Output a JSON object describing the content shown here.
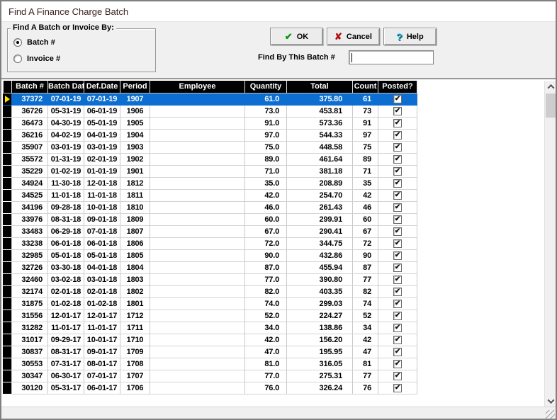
{
  "window": {
    "title": "Find A Finance Charge Batch"
  },
  "icons": {
    "check": "✔",
    "cross": "✘",
    "question": "?"
  },
  "toolbar": {
    "groupbox_label": "Find A Batch or Invoice By:",
    "radio_batch": {
      "label": "Batch #",
      "selected": true
    },
    "radio_invoice": {
      "label": "Invoice #",
      "selected": false
    },
    "ok": {
      "label": "OK"
    },
    "cancel": {
      "label": "Cancel"
    },
    "help": {
      "label": "Help"
    },
    "find_label": "Find By This Batch #",
    "find_value": ""
  },
  "table": {
    "columns": [
      "Batch #",
      "Batch Date",
      "Def.Date",
      "Period",
      "Employee",
      "Quantity",
      "Total",
      "Count",
      "Posted?"
    ],
    "selected_index": 0,
    "rows": [
      {
        "batch": "37372",
        "batch_date": "07-01-19",
        "def_date": "07-01-19",
        "period": "1907",
        "employee": "",
        "quantity": "61.0",
        "total": "375.80",
        "count": "61",
        "posted": true
      },
      {
        "batch": "36726",
        "batch_date": "05-31-19",
        "def_date": "06-01-19",
        "period": "1906",
        "employee": "",
        "quantity": "73.0",
        "total": "453.81",
        "count": "73",
        "posted": true
      },
      {
        "batch": "36473",
        "batch_date": "04-30-19",
        "def_date": "05-01-19",
        "period": "1905",
        "employee": "",
        "quantity": "91.0",
        "total": "573.36",
        "count": "91",
        "posted": true
      },
      {
        "batch": "36216",
        "batch_date": "04-02-19",
        "def_date": "04-01-19",
        "period": "1904",
        "employee": "",
        "quantity": "97.0",
        "total": "544.33",
        "count": "97",
        "posted": true
      },
      {
        "batch": "35907",
        "batch_date": "03-01-19",
        "def_date": "03-01-19",
        "period": "1903",
        "employee": "",
        "quantity": "75.0",
        "total": "448.58",
        "count": "75",
        "posted": true
      },
      {
        "batch": "35572",
        "batch_date": "01-31-19",
        "def_date": "02-01-19",
        "period": "1902",
        "employee": "",
        "quantity": "89.0",
        "total": "461.64",
        "count": "89",
        "posted": true
      },
      {
        "batch": "35229",
        "batch_date": "01-02-19",
        "def_date": "01-01-19",
        "period": "1901",
        "employee": "",
        "quantity": "71.0",
        "total": "381.18",
        "count": "71",
        "posted": true
      },
      {
        "batch": "34924",
        "batch_date": "11-30-18",
        "def_date": "12-01-18",
        "period": "1812",
        "employee": "",
        "quantity": "35.0",
        "total": "208.89",
        "count": "35",
        "posted": true
      },
      {
        "batch": "34525",
        "batch_date": "11-01-18",
        "def_date": "11-01-18",
        "period": "1811",
        "employee": "",
        "quantity": "42.0",
        "total": "254.70",
        "count": "42",
        "posted": true
      },
      {
        "batch": "34196",
        "batch_date": "09-28-18",
        "def_date": "10-01-18",
        "period": "1810",
        "employee": "",
        "quantity": "46.0",
        "total": "261.43",
        "count": "46",
        "posted": true
      },
      {
        "batch": "33976",
        "batch_date": "08-31-18",
        "def_date": "09-01-18",
        "period": "1809",
        "employee": "",
        "quantity": "60.0",
        "total": "299.91",
        "count": "60",
        "posted": true
      },
      {
        "batch": "33483",
        "batch_date": "06-29-18",
        "def_date": "07-01-18",
        "period": "1807",
        "employee": "",
        "quantity": "67.0",
        "total": "290.41",
        "count": "67",
        "posted": true
      },
      {
        "batch": "33238",
        "batch_date": "06-01-18",
        "def_date": "06-01-18",
        "period": "1806",
        "employee": "",
        "quantity": "72.0",
        "total": "344.75",
        "count": "72",
        "posted": true
      },
      {
        "batch": "32985",
        "batch_date": "05-01-18",
        "def_date": "05-01-18",
        "period": "1805",
        "employee": "",
        "quantity": "90.0",
        "total": "432.86",
        "count": "90",
        "posted": true
      },
      {
        "batch": "32726",
        "batch_date": "03-30-18",
        "def_date": "04-01-18",
        "period": "1804",
        "employee": "",
        "quantity": "87.0",
        "total": "455.94",
        "count": "87",
        "posted": true
      },
      {
        "batch": "32460",
        "batch_date": "03-02-18",
        "def_date": "03-01-18",
        "period": "1803",
        "employee": "",
        "quantity": "77.0",
        "total": "390.80",
        "count": "77",
        "posted": true
      },
      {
        "batch": "32174",
        "batch_date": "02-01-18",
        "def_date": "02-01-18",
        "period": "1802",
        "employee": "",
        "quantity": "82.0",
        "total": "403.35",
        "count": "82",
        "posted": true
      },
      {
        "batch": "31875",
        "batch_date": "01-02-18",
        "def_date": "01-02-18",
        "period": "1801",
        "employee": "",
        "quantity": "74.0",
        "total": "299.03",
        "count": "74",
        "posted": true
      },
      {
        "batch": "31556",
        "batch_date": "12-01-17",
        "def_date": "12-01-17",
        "period": "1712",
        "employee": "",
        "quantity": "52.0",
        "total": "224.27",
        "count": "52",
        "posted": true
      },
      {
        "batch": "31282",
        "batch_date": "11-01-17",
        "def_date": "11-01-17",
        "period": "1711",
        "employee": "",
        "quantity": "34.0",
        "total": "138.86",
        "count": "34",
        "posted": true
      },
      {
        "batch": "31017",
        "batch_date": "09-29-17",
        "def_date": "10-01-17",
        "period": "1710",
        "employee": "",
        "quantity": "42.0",
        "total": "156.20",
        "count": "42",
        "posted": true
      },
      {
        "batch": "30837",
        "batch_date": "08-31-17",
        "def_date": "09-01-17",
        "period": "1709",
        "employee": "",
        "quantity": "47.0",
        "total": "195.95",
        "count": "47",
        "posted": true
      },
      {
        "batch": "30553",
        "batch_date": "07-31-17",
        "def_date": "08-01-17",
        "period": "1708",
        "employee": "",
        "quantity": "81.0",
        "total": "316.05",
        "count": "81",
        "posted": true
      },
      {
        "batch": "30347",
        "batch_date": "06-30-17",
        "def_date": "07-01-17",
        "period": "1707",
        "employee": "",
        "quantity": "77.0",
        "total": "275.31",
        "count": "77",
        "posted": true
      },
      {
        "batch": "30120",
        "batch_date": "05-31-17",
        "def_date": "06-01-17",
        "period": "1706",
        "employee": "",
        "quantity": "76.0",
        "total": "326.24",
        "count": "76",
        "posted": true
      }
    ]
  },
  "colors": {
    "selection": "#0d6ed2",
    "header_bg": "#000000",
    "indicator_arrow": "#ffe400",
    "ok_icon": "#089b08",
    "cancel_icon": "#b40d0d",
    "help_icon": "#11a3c9"
  }
}
